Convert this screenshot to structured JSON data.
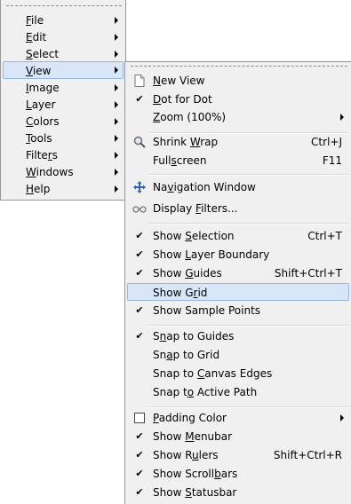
{
  "main_menu": {
    "items": [
      {
        "pre": "",
        "mn": "F",
        "post": "ile"
      },
      {
        "pre": "",
        "mn": "E",
        "post": "dit"
      },
      {
        "pre": "",
        "mn": "S",
        "post": "elect"
      },
      {
        "pre": "",
        "mn": "V",
        "post": "iew"
      },
      {
        "pre": "",
        "mn": "I",
        "post": "mage"
      },
      {
        "pre": "",
        "mn": "L",
        "post": "ayer"
      },
      {
        "pre": "",
        "mn": "C",
        "post": "olors"
      },
      {
        "pre": "",
        "mn": "T",
        "post": "ools"
      },
      {
        "pre": "Filte",
        "mn": "r",
        "post": "s"
      },
      {
        "pre": "",
        "mn": "W",
        "post": "indows"
      },
      {
        "pre": "",
        "mn": "H",
        "post": "elp"
      }
    ]
  },
  "view_menu": {
    "new_view": {
      "pre": "",
      "mn": "N",
      "post": "ew View"
    },
    "dot_for_dot": {
      "pre": "",
      "mn": "D",
      "post": "ot for Dot"
    },
    "zoom": {
      "pre": "",
      "mn": "Z",
      "post": "oom (100%)"
    },
    "shrink_wrap": {
      "pre": "Shrink ",
      "mn": "W",
      "post": "rap",
      "shortcut": "Ctrl+J"
    },
    "fullscreen": {
      "pre": "Full",
      "mn": "s",
      "post": "creen",
      "shortcut": "F11"
    },
    "navigation_window": {
      "pre": "Na",
      "mn": "v",
      "post": "igation Window"
    },
    "display_filters": {
      "pre": "Display ",
      "mn": "F",
      "post": "ilters..."
    },
    "show_selection": {
      "pre": "Show ",
      "mn": "S",
      "post": "election",
      "shortcut": "Ctrl+T"
    },
    "show_layer_boundary": {
      "pre": "Show ",
      "mn": "L",
      "post": "ayer Boundary"
    },
    "show_guides": {
      "pre": "Show ",
      "mn": "G",
      "post": "uides",
      "shortcut": "Shift+Ctrl+T"
    },
    "show_grid": {
      "pre": "Show G",
      "mn": "r",
      "post": "id"
    },
    "show_sample_points": {
      "pre": "Show Sample Points",
      "mn": "",
      "post": ""
    },
    "snap_guides": {
      "pre": "S",
      "mn": "n",
      "post": "ap to Guides"
    },
    "snap_grid": {
      "pre": "Sn",
      "mn": "a",
      "post": "p to Grid"
    },
    "snap_canvas": {
      "pre": "Snap to ",
      "mn": "C",
      "post": "anvas Edges"
    },
    "snap_path": {
      "pre": "Snap t",
      "mn": "o",
      "post": " Active Path"
    },
    "padding_color": {
      "pre": "",
      "mn": "P",
      "post": "adding Color"
    },
    "show_menubar": {
      "pre": "Show ",
      "mn": "M",
      "post": "enubar"
    },
    "show_rulers": {
      "pre": "Show R",
      "mn": "u",
      "post": "lers",
      "shortcut": "Shift+Ctrl+R"
    },
    "show_scrollbars": {
      "pre": "Show Scroll",
      "mn": "b",
      "post": "ars"
    },
    "show_statusbar": {
      "pre": "Show ",
      "mn": "S",
      "post": "tatusbar"
    }
  },
  "colors": {
    "highlight_bg": "#d9e6f7",
    "highlight_border": "#98b7dc",
    "menu_bg": "#f0f0f0"
  }
}
